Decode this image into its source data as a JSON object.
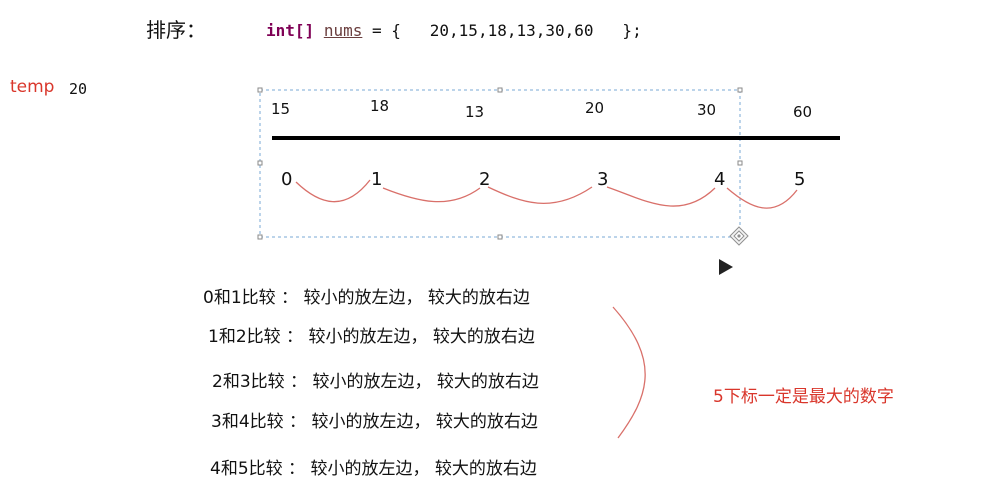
{
  "header": {
    "title": "排序：",
    "code_keyword": "int[]",
    "code_var": "nums",
    "code_rest": " = {   20,15,18,13,30,60   };"
  },
  "temp": {
    "label": "temp",
    "value": "20"
  },
  "array_values": [
    "15",
    "18",
    "13",
    "20",
    "30",
    "60"
  ],
  "indices": [
    "0",
    "1",
    "2",
    "3",
    "4",
    "5"
  ],
  "rules": [
    "0和1比较 ： 较小的放左边， 较大的放右边",
    "1和2比较 ： 较小的放左边， 较大的放右边",
    "2和3比较 ： 较小的放左边， 较大的放右边",
    "3和4比较 ： 较小的放左边， 较大的放右边",
    "4和5比较 ： 较小的放左边， 较大的放右边"
  ],
  "conclusion": "5下标一定是最大的数字",
  "colors": {
    "annotation": "#d9362b",
    "curve": "#d9706a",
    "selection": "#7aaad6"
  },
  "icons": [
    "move-handle-icon",
    "play-icon"
  ]
}
